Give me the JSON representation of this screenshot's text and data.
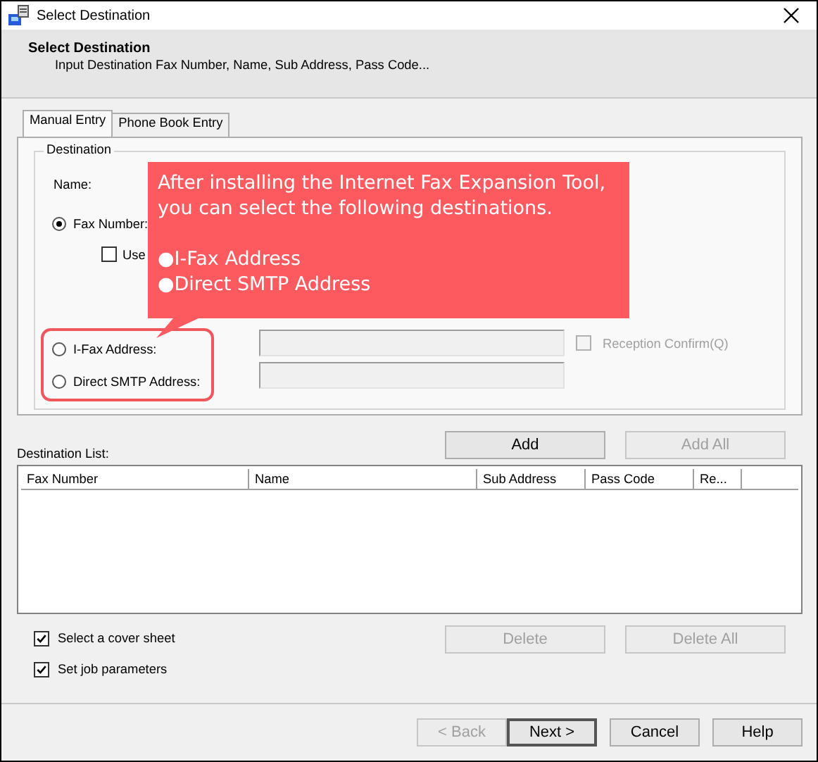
{
  "window": {
    "title": "Select Destination"
  },
  "header": {
    "title": "Select Destination",
    "subtitle": "Input Destination Fax Number, Name, Sub Address, Pass Code..."
  },
  "tabs": [
    {
      "label": "Manual Entry",
      "selected": true
    },
    {
      "label": "Phone Book Entry",
      "selected": false
    }
  ],
  "destination": {
    "legend": "Destination",
    "name_label": "Name:",
    "fax": {
      "label": "Fax Number:",
      "selected": true
    },
    "use_option": {
      "label": "Use",
      "checked": false
    },
    "extra_types": [
      {
        "label": "I-Fax Address:",
        "selected": false
      },
      {
        "label": "Direct SMTP Address:",
        "selected": false
      }
    ],
    "reception_confirm": {
      "label": "Reception Confirm(Q)",
      "checked": false,
      "disabled": true
    }
  },
  "callout": {
    "lines": [
      "After installing the Internet Fax Expansion Tool,",
      " you can select the following destinations."
    ],
    "bullets": [
      "●I-Fax Address",
      "●Direct SMTP Address"
    ]
  },
  "list_buttons": [
    {
      "label": "Add",
      "disabled": false
    },
    {
      "label": "Add All",
      "disabled": true
    }
  ],
  "destination_list": {
    "label": "Destination List:",
    "columns": [
      "Fax Number",
      "Name",
      "Sub Address",
      "Pass Code",
      "Re..."
    ]
  },
  "options": [
    {
      "label": "Select a cover sheet",
      "checked": true
    },
    {
      "label": "Set job parameters",
      "checked": true
    }
  ],
  "delete_buttons": [
    {
      "label": "Delete",
      "disabled": true
    },
    {
      "label": "Delete All",
      "disabled": true
    }
  ],
  "footer_buttons": [
    {
      "label": "< Back",
      "disabled": true,
      "default": false
    },
    {
      "label": "Next >",
      "disabled": false,
      "default": true
    },
    {
      "label": "Cancel",
      "disabled": false,
      "default": false
    },
    {
      "label": "Help",
      "disabled": false,
      "default": false
    }
  ]
}
